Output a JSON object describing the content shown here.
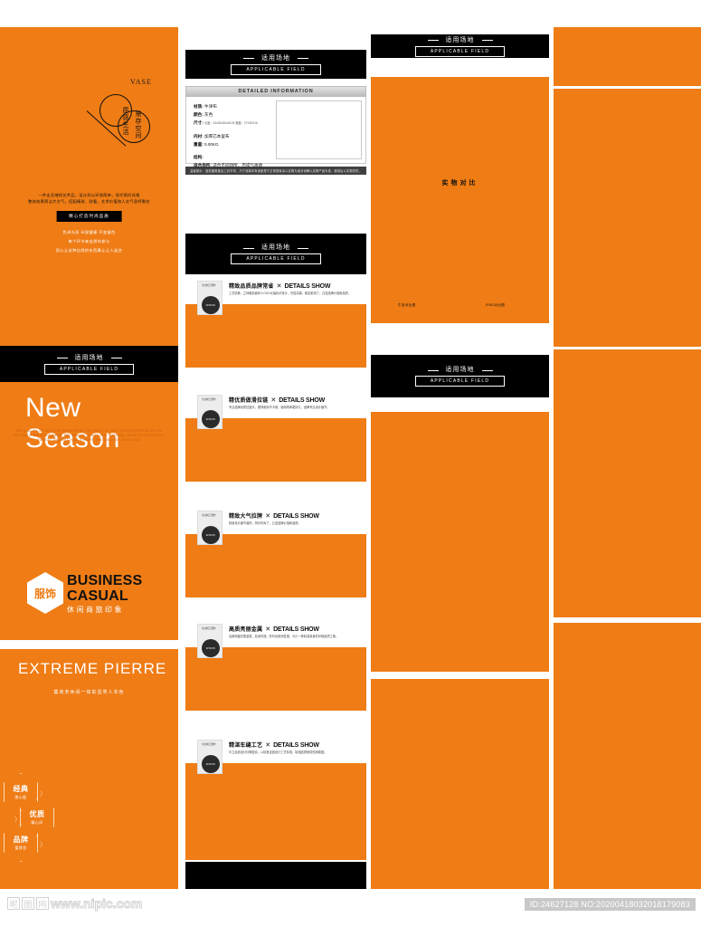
{
  "page": {
    "background": "#ffffff",
    "accent_orange": "#ef7c15",
    "black": "#000000"
  },
  "banner": {
    "cn": "适用场地",
    "en": "APPLICABLE FIELD"
  },
  "hero": {
    "vase_label": "VASE",
    "vertical_1": "质感生活",
    "vertical_2": "需存空间",
    "paragraph_line1": "一件走灵魂的艺术品，设计形以环保简单，现代简约风格",
    "paragraph_line2": "整体效果简洁大方气，搭配精致、耐看，艺术价值和人文气息呼聚合",
    "tag": "精心打造时尚品质",
    "sub_line1": "色泽光亮 环保健康 不变褪色",
    "sub_line2": "每个环节来自然的参与",
    "sub_line3": "用心让这种自然的东西最让让人迷恋",
    "new_season": "New Season",
    "new_season_sub_line1": "THE QUALITY OF LIFE IS DETERMINED BY THE TASTE OF LIFE. THE PERCEPTION OF LIFE",
    "new_season_sub_line2": "BECOME MORE CONSUMERS, THE DEMAND IS NOT JUST MATERIAL, MORE OF A SPIRITUAL",
    "new_season_sub_line3": "PURSUIT ONE WILL HAVE A HEART THAT WILL NOT GROW OLD.",
    "brand_hex": "服饰",
    "brand_line1": "BUSINESS",
    "brand_line2": "CASUAL",
    "brand_line3": "休闲商旅印象",
    "extreme": "EXTREME PIERRE",
    "extreme_sub": "集商务休闲一体彰显男人本色",
    "badges": [
      {
        "title": "经典",
        "sub": "独心配"
      },
      {
        "title": "优质",
        "sub": "精心间"
      },
      {
        "title": "品牌",
        "sub": "值得信"
      }
    ],
    "chevron": "〉"
  },
  "spec": {
    "header": "DETAILED INFORMATION",
    "rows": [
      {
        "key": "材质:",
        "value": "牛津布",
        "small": ""
      },
      {
        "key": "颜色:",
        "value": "灰色",
        "small": ""
      },
      {
        "key": "尺寸:",
        "value": "",
        "small": "长度：32x20x30x40CM  宽度：27X20X16"
      },
      {
        "key": "",
        "value": "",
        "small": ""
      },
      {
        "key": "内衬:",
        "value": "加厚芯本里布",
        "small": ""
      },
      {
        "key": "重量:",
        "value": "0.00KG",
        "small": ""
      },
      {
        "key": "",
        "value": "",
        "small": ""
      },
      {
        "key": "结构:",
        "value": "",
        "small": ""
      },
      {
        "key": "适合场所:",
        "value": "适合不同场所、百搭气质款",
        "small": ""
      }
    ],
    "notice": "温馨提示：因拍摄角度及工具不同，尺寸测量均有误差属于正常现象请以实物为准请谅解以实物产品为准，使用后以实物供货。"
  },
  "details_rows": [
    {
      "cn": "精致品质品牌常省",
      "sep": "✕",
      "en": "DETAILS SHOW",
      "desc": "工艺精美、立体裁剪面料人OGO大幅标识设计，尽显高端、稳定耐用了，凸显品牌价值和品质。",
      "thumb_label": "WORK",
      "thumb_top": "专业精工细作"
    },
    {
      "cn": "精优质做滑拉链",
      "sep": "✕",
      "en": "DETAILS SHOW",
      "desc": "专业品牌优质拉链头，顺滑耐用不卡顿，使用寿命更持久，品牌专业设计细节。",
      "thumb_label": "WORK",
      "thumb_top": "专业精工细作"
    },
    {
      "cn": "精致大气拉牌",
      "sep": "✕",
      "en": "DETAILS SHOW",
      "desc": "精致设计细节装饰，简约时尚了，凸显品牌价值和品质。",
      "thumb_label": "WORK",
      "thumb_top": "专业精工细作"
    },
    {
      "cn": "高质亮丽金属",
      "sep": "✕",
      "en": "DETAILS SHOW",
      "desc": "高频电镀亮丽金属，色泽亮丽，防氧化耐用性强，与小一种精准量身的印制品质之美。",
      "thumb_label": "WORK",
      "thumb_top": "专业精工细作"
    },
    {
      "cn": "精湛车缝工艺",
      "sep": "✕",
      "en": "DETAILS SHOW",
      "desc": "中立走线走针针脚密实，以精良走缝设计工艺标准，增强品质耐用性和稳固。",
      "thumb_label": "WORK",
      "thumb_top": "专业精工细作"
    }
  ],
  "compare": {
    "title": "实物对比",
    "label_left": "牛皮对比图",
    "label_right": "IPAD对比图"
  },
  "footer": {
    "watermark_glyphs": [
      "昵",
      "图",
      "网"
    ],
    "watermark_text": "www.nipic.com",
    "id_text": "ID:24627128 NO:20200418032018179083"
  }
}
